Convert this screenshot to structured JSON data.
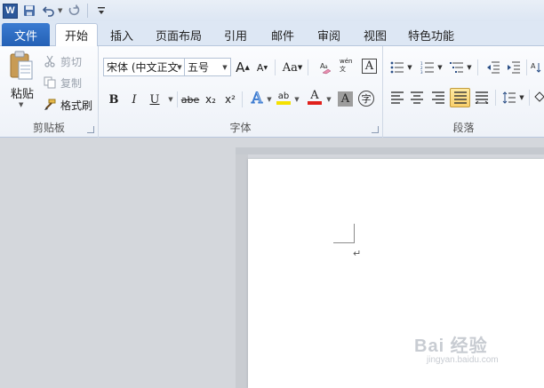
{
  "qat": {
    "app_icon": "W",
    "icons": [
      "save-icon",
      "undo-icon",
      "redo-icon",
      "customize-icon"
    ]
  },
  "tabs": {
    "file": "文件",
    "items": [
      "开始",
      "插入",
      "页面布局",
      "引用",
      "邮件",
      "审阅",
      "视图",
      "特色功能"
    ],
    "active": "开始"
  },
  "clipboard": {
    "paste": "粘贴",
    "cut": "剪切",
    "copy": "复制",
    "format_painter": "格式刷",
    "label": "剪贴板"
  },
  "font": {
    "family": "宋体 (中文正文",
    "size": "五号",
    "grow": "A",
    "shrink": "A",
    "case": "Aa",
    "bold": "B",
    "italic": "I",
    "underline": "U",
    "strike": "abe",
    "subscript": "x₂",
    "superscript": "x²",
    "text_effect": "A",
    "highlight": "ab",
    "font_color": "A",
    "char_shading": "A",
    "enclosed": "字",
    "phonetic": "wén 文",
    "label": "字体"
  },
  "paragraph": {
    "label": "段落"
  },
  "colors": {
    "file_tab": "#2b6cc4",
    "highlight": "#f5e100",
    "font_color": "#e0201b",
    "active_button": "#f9d06c"
  },
  "watermark": {
    "top": "Bai 经验",
    "bottom": "jingyan.baidu.com"
  }
}
